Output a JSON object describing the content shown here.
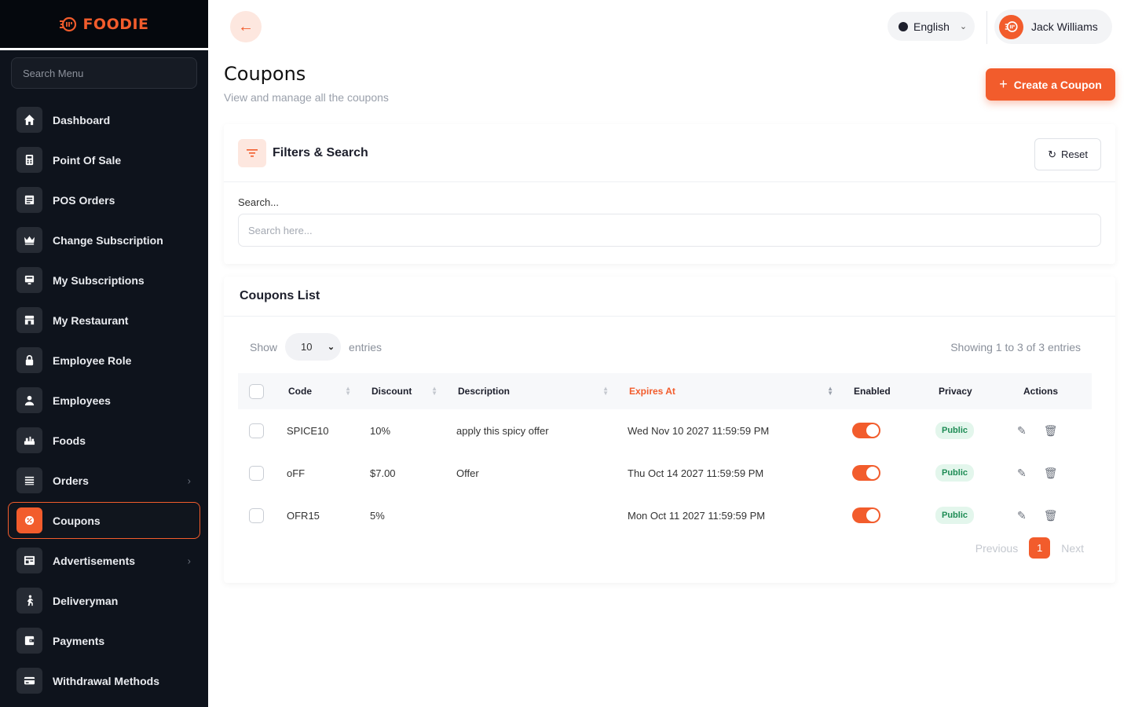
{
  "brand": {
    "name": "FOODIE",
    "color": "#f25c2c"
  },
  "sidebar": {
    "search_placeholder": "Search Menu",
    "items": [
      {
        "label": "Dashboard",
        "icon": "home-icon"
      },
      {
        "label": "Point Of Sale",
        "icon": "calculator-icon"
      },
      {
        "label": "POS Orders",
        "icon": "receipt-icon"
      },
      {
        "label": "Change Subscription",
        "icon": "crown-icon"
      },
      {
        "label": "My Subscriptions",
        "icon": "monitor-icon"
      },
      {
        "label": "My Restaurant",
        "icon": "store-icon"
      },
      {
        "label": "Employee Role",
        "icon": "lock-icon"
      },
      {
        "label": "Employees",
        "icon": "user-icon"
      },
      {
        "label": "Foods",
        "icon": "food-icon"
      },
      {
        "label": "Orders",
        "icon": "list-icon",
        "has_submenu": true
      },
      {
        "label": "Coupons",
        "icon": "coupon-icon",
        "active": true
      },
      {
        "label": "Advertisements",
        "icon": "ad-icon",
        "has_submenu": true
      },
      {
        "label": "Deliveryman",
        "icon": "runner-icon"
      },
      {
        "label": "Payments",
        "icon": "wallet-icon"
      },
      {
        "label": "Withdrawal Methods",
        "icon": "card-icon"
      }
    ]
  },
  "header": {
    "language": "English",
    "user_name": "Jack Williams"
  },
  "page": {
    "title": "Coupons",
    "subtitle": "View and manage all the coupons",
    "create_label": "Create a Coupon"
  },
  "filters": {
    "title": "Filters & Search",
    "reset_label": "Reset",
    "search_label": "Search...",
    "search_placeholder": "Search here..."
  },
  "list": {
    "title": "Coupons List",
    "show_label": "Show",
    "page_size": "10",
    "entries_label": "entries",
    "showing_text": "Showing 1 to 3 of 3 entries",
    "columns": [
      "Code",
      "Discount",
      "Description",
      "Expires At",
      "Enabled",
      "Privacy",
      "Actions"
    ],
    "rows": [
      {
        "code": "SPICE10",
        "discount": "10%",
        "description": "apply this spicy offer",
        "expires": "Wed Nov 10 2027 11:59:59 PM",
        "enabled": true,
        "privacy": "Public"
      },
      {
        "code": "oFF",
        "discount": "$7.00",
        "description": "Offer",
        "expires": "Thu Oct 14 2027 11:59:59 PM",
        "enabled": true,
        "privacy": "Public"
      },
      {
        "code": "OFR15",
        "discount": "5%",
        "description": "",
        "expires": "Mon Oct 11 2027 11:59:59 PM",
        "enabled": true,
        "privacy": "Public"
      }
    ],
    "pagination": {
      "previous": "Previous",
      "current": "1",
      "next": "Next"
    }
  }
}
